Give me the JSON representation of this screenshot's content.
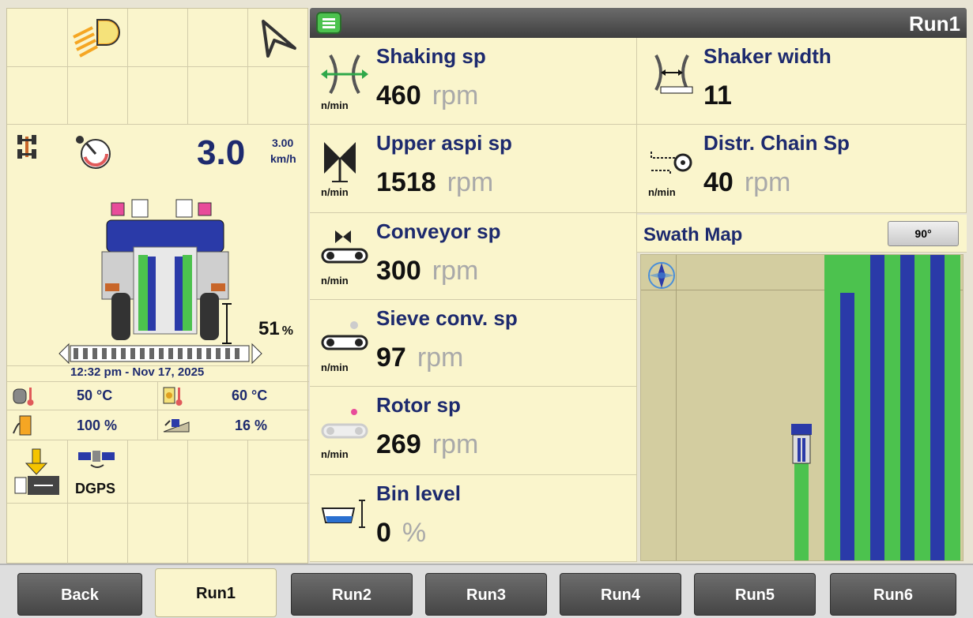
{
  "header": {
    "title": "Run1"
  },
  "left": {
    "speed_value": "3.0",
    "speed_small": "3.00",
    "speed_unit": "km/h",
    "height_percent": "51",
    "height_unit": "%",
    "datetime": "12:32 pm - Nov 17, 2025",
    "status": [
      {
        "value": "50 °C"
      },
      {
        "value": "60 °C"
      },
      {
        "value": "100 %"
      },
      {
        "value": "16 %"
      }
    ],
    "gps_label": "DGPS"
  },
  "tiles": [
    {
      "label": "Shaking sp",
      "value": "460",
      "unit": "rpm",
      "nmin": "n/min",
      "icon": "shaking-icon"
    },
    {
      "label": "Shaker width",
      "value": "11",
      "unit": "",
      "nmin": "",
      "icon": "shaker-width-icon"
    },
    {
      "label": "Upper aspi sp",
      "value": "1518",
      "unit": "rpm",
      "nmin": "n/min",
      "icon": "upper-aspi-icon"
    },
    {
      "label": "Distr. Chain Sp",
      "value": "40",
      "unit": "rpm",
      "nmin": "n/min",
      "icon": "distr-chain-icon"
    },
    {
      "label": "Conveyor sp",
      "value": "300",
      "unit": "rpm",
      "nmin": "n/min",
      "icon": "conveyor-icon"
    },
    {
      "label": "Sieve conv. sp",
      "value": "97",
      "unit": "rpm",
      "nmin": "n/min",
      "icon": "sieve-conveyor-icon"
    },
    {
      "label": "Rotor sp",
      "value": "269",
      "unit": "rpm",
      "nmin": "n/min",
      "icon": "rotor-icon"
    },
    {
      "label": "Bin level",
      "value": "0",
      "unit": "%",
      "nmin": "",
      "icon": "bin-level-icon"
    }
  ],
  "swath_map": {
    "title": "Swath Map",
    "angle_button": "90°"
  },
  "bottom_tabs": [
    "Back",
    "Run1",
    "Run2",
    "Run3",
    "Run4",
    "Run5",
    "Run6"
  ],
  "colors": {
    "panel": "#faf5cc",
    "label": "#1d2a6e",
    "stripe_green": "#4cc24e",
    "stripe_blue": "#2a3aa8"
  }
}
